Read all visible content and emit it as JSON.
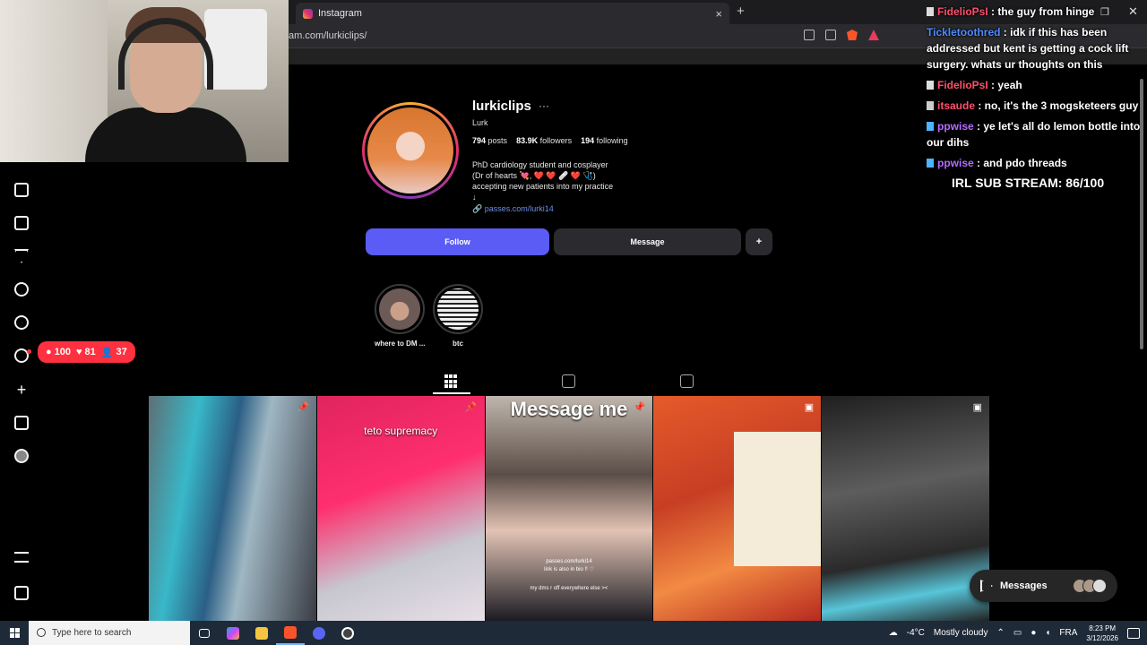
{
  "browser": {
    "tab_title": "Instagram",
    "tab_close": "×",
    "new_tab": "+",
    "url": "am.com/lurkiclips/"
  },
  "profile": {
    "username": "lurkiclips",
    "more": "···",
    "full_name": "Lurk",
    "posts_count": "794",
    "posts_label": "posts",
    "followers_count": "83.9K",
    "followers_label": "followers",
    "following_count": "194",
    "following_label": "following",
    "bio_line1": "PhD cardiology student and cosplayer",
    "bio_line2": "(Dr of hearts 💘, ❤️ ❤️ 🩹 ❤️ 🩺)",
    "bio_line3": "accepting new patients into my practice",
    "bio_line4": "↓",
    "link": "passes.com/lurki14"
  },
  "actions": {
    "follow": "Follow",
    "message": "Message",
    "add_user": "+"
  },
  "highlights": [
    {
      "label": "where to DM ..."
    },
    {
      "label": "btc"
    }
  ],
  "notifications": {
    "comments": "100",
    "likes": "81",
    "follows": "37"
  },
  "posts": [
    {
      "caption": "",
      "pinned": true
    },
    {
      "caption": "teto supremacy",
      "pinned": true
    },
    {
      "caption": "Message me",
      "pinned": true,
      "small1": "passes.com/lurki14",
      "small2": "link is also in bio !! ♡",
      "small3": "my dms r off everywhere else ><"
    },
    {
      "caption": "",
      "pinned": false,
      "reel": true
    },
    {
      "caption": "",
      "pinned": false,
      "reel": true
    }
  ],
  "messages_pill": {
    "label": "Messages"
  },
  "chat": [
    {
      "user": "FidelioPsI",
      "color": "#ff4f6d",
      "text": " : the guy from hinge"
    },
    {
      "user": "Tickletoothred",
      "color": "#4f8cff",
      "text": " : idk if this has been addressed but kent is getting a cock lift surgery. whats ur thoughts on this"
    },
    {
      "user": "FidelioPsI",
      "color": "#ff4f6d",
      "text": " : yeah"
    },
    {
      "user": "itsaude",
      "color": "#ff4f6d",
      "text": " : no, it's the 3 mogsketeers guy"
    },
    {
      "user": "ppwise",
      "color": "#b46bff",
      "text": " : ye let's all do lemon bottle into our dihs"
    },
    {
      "user": "ppwise",
      "color": "#b46bff",
      "text": " : and pdo threads"
    }
  ],
  "sub_goal": "IRL SUB STREAM: 86/100",
  "taskbar": {
    "search_placeholder": "Type here to search",
    "weather_temp": "-4°C",
    "weather_desc": "Mostly cloudy",
    "lang": "FRA",
    "time": "8:23 PM",
    "date": "3/12/2026"
  }
}
